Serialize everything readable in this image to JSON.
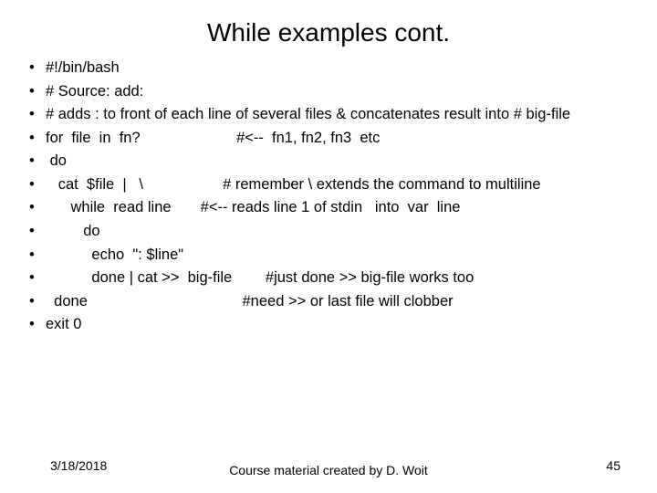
{
  "title": "While examples cont.",
  "lines": [
    "#!/bin/bash",
    "# Source: add:",
    "# adds : to front of each line of several files & concatenates  result into # big-file",
    "for  file  in  fn?                       #<--  fn1, fn2, fn3  etc",
    " do",
    "   cat  $file  |   \\                   # remember \\ extends the command to multiline",
    "      while  read line       #<-- reads line 1 of stdin   into  var  line",
    "         do",
    "           echo  \": $line\"",
    "           done | cat >>  big-file        #just done >> big-file works too",
    "  done                                     #need >> or last file will clobber",
    "exit 0"
  ],
  "footer": {
    "date": "3/18/2018",
    "center": "Course material created by D. Woit",
    "page": "45"
  }
}
